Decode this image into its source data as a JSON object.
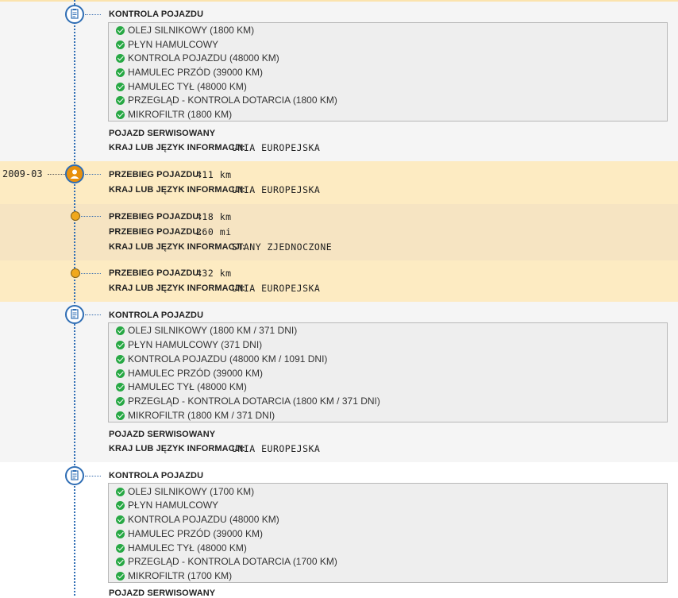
{
  "labels": {
    "kontrola": "KONTROLA POJAZDU",
    "serwisowany": "POJAZD SERWISOWANY",
    "kraj": "KRAJ LUB JĘZYK INFORMACJI:",
    "przebieg": "PRZEBIEG POJAZDU:"
  },
  "entry1": {
    "items": [
      "OLEJ SILNIKOWY (1800 KM)",
      "PŁYN HAMULCOWY",
      "KONTROLA POJAZDU (48000 KM)",
      "HAMULEC PRZÓD (39000 KM)",
      "HAMULEC TYŁ (48000 KM)",
      "PRZEGLĄD - KONTROLA DOTARCIA (1800 KM)",
      "MIKROFILTR (1800 KM)"
    ],
    "country": "UNIA EUROPEJSKA"
  },
  "entry2": {
    "date": "2009-03",
    "mileage": "411 km",
    "country": "UNIA EUROPEJSKA"
  },
  "entry3": {
    "mileage_km": "418 km",
    "mileage_mi": "260 mi",
    "country": "STANY ZJEDNOCZONE"
  },
  "entry4": {
    "mileage": "432 km",
    "country": "UNIA EUROPEJSKA"
  },
  "entry5": {
    "items": [
      "OLEJ SILNIKOWY (1800 KM / 371 DNI)",
      "PŁYN HAMULCOWY (371 DNI)",
      "KONTROLA POJAZDU (48000 KM / 1091 DNI)",
      "HAMULEC PRZÓD (39000 KM)",
      "HAMULEC TYŁ (48000 KM)",
      "PRZEGLĄD - KONTROLA DOTARCIA (1800 KM / 371 DNI)",
      "MIKROFILTR (1800 KM / 371 DNI)"
    ],
    "country": "UNIA EUROPEJSKA"
  },
  "entry6": {
    "items": [
      "OLEJ SILNIKOWY (1700 KM)",
      "PŁYN HAMULCOWY",
      "KONTROLA POJAZDU (48000 KM)",
      "HAMULEC PRZÓD (39000 KM)",
      "HAMULEC TYŁ (48000 KM)",
      "PRZEGLĄD - KONTROLA DOTARCIA (1700 KM)",
      "MIKROFILTR (1700 KM)"
    ]
  },
  "icons": {
    "service": "clipboard-icon",
    "owner": "person-icon",
    "mileage": "dot-icon",
    "check": "check-circle-icon"
  },
  "colors": {
    "timeline": "#2e6db4",
    "check": "#27a844",
    "owner_badge": "#e8900c",
    "dot": "#f0a81c",
    "highlight": "#fdebc2"
  }
}
